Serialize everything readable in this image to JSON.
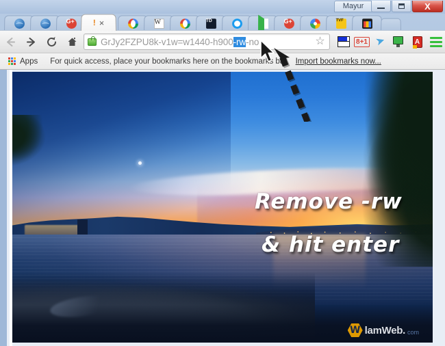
{
  "window": {
    "user_button": "Mayur",
    "minimize": "minimize-icon",
    "maximize": "maximize-icon",
    "close": "X"
  },
  "tabs": [
    {
      "favicon": "globe-icon",
      "label": ""
    },
    {
      "favicon": "globe-icon",
      "label": ""
    },
    {
      "favicon": "google-plus-icon",
      "label": ""
    },
    {
      "favicon": "warning-icon",
      "label": "",
      "close": "×",
      "active": true
    },
    {
      "favicon": "google-drive-icon",
      "label": ""
    },
    {
      "favicon": "wikipedia-icon",
      "label": "W"
    },
    {
      "favicon": "google-drive-icon",
      "label": ""
    },
    {
      "favicon": "td-icon",
      "label": "TD"
    },
    {
      "favicon": "office-icon",
      "label": ""
    },
    {
      "favicon": "google-play-icon",
      "label": ""
    },
    {
      "favicon": "google-plus-icon",
      "label": ""
    },
    {
      "favicon": "google-photos-icon",
      "label": ""
    },
    {
      "favicon": "tvf-icon",
      "label": "TVF"
    },
    {
      "favicon": "shopping-bag-icon",
      "label": ""
    }
  ],
  "toolbar": {
    "back": "back-arrow-icon",
    "forward": "forward-arrow-icon",
    "reload": "reload-icon",
    "home": "home-icon",
    "security_icon": "lock-icon",
    "url_prefix": "",
    "url_before": "GrJy2FZPU8k-v1w=w1440-h900",
    "url_selected": "-rw",
    "url_after": "-no",
    "bookmark_star": "☆",
    "extensions": [
      {
        "name": "blue-bar-extension-icon"
      },
      {
        "name": "google-plus-one-icon",
        "label": "8+1"
      },
      {
        "name": "twitter-bird-icon",
        "label": "➤"
      },
      {
        "name": "green-monitor-extension-icon"
      },
      {
        "name": "red-dictionary-icon",
        "label": "A"
      },
      {
        "name": "chrome-menu-icon"
      }
    ]
  },
  "bookmarks_bar": {
    "apps_label": "Apps",
    "hint": "For quick access, place your bookmarks here on the bookmarks bar.",
    "import_link": "Import bookmarks now..."
  },
  "page": {
    "annotation_line1": "Remove -rw",
    "annotation_line2": "& hit enter",
    "arrow": "dashed-arrow-icon",
    "cursor": "mouse-pointer-icon",
    "watermark_logo": "W",
    "watermark_name": "lamWeb.",
    "watermark_tld": "com"
  },
  "colors": {
    "selection_blue": "#2f8ce0",
    "close_red": "#bb2d21",
    "accent_green": "#35bf3a",
    "annotation_white": "#ffffff",
    "watermark_orange": "#f0a500"
  }
}
